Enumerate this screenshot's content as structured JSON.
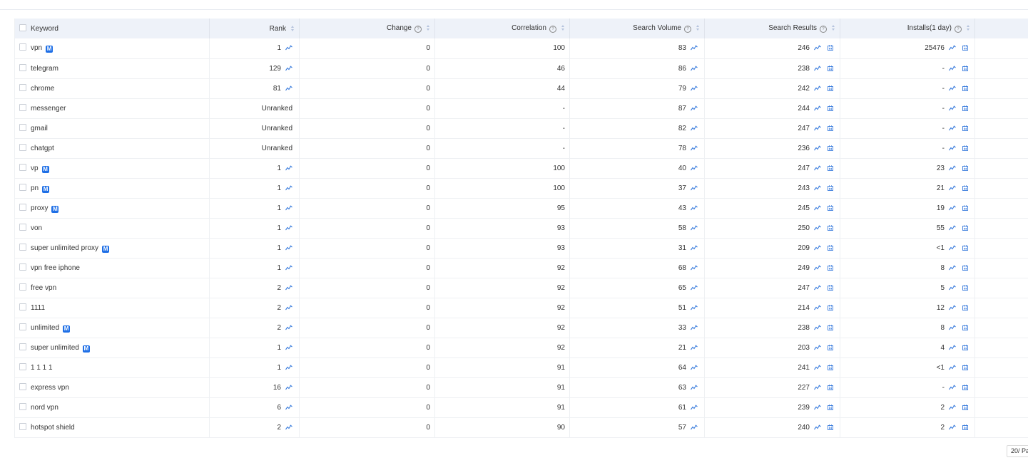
{
  "columns": {
    "keyword": "Keyword",
    "rank": "Rank",
    "change": "Change",
    "correlation": "Correlation",
    "search_volume": "Search Volume",
    "search_results": "Search Results",
    "installs": "Installs(1 day)"
  },
  "badge_label": "M",
  "pager_label": "20/ Pa",
  "rows": [
    {
      "keyword": "vpn",
      "badge": true,
      "rank": "1",
      "change": "0",
      "correlation": "100",
      "volume": "83",
      "results": "246",
      "installs": "25476"
    },
    {
      "keyword": "telegram",
      "badge": false,
      "rank": "129",
      "change": "0",
      "correlation": "46",
      "volume": "86",
      "results": "238",
      "installs": "-"
    },
    {
      "keyword": "chrome",
      "badge": false,
      "rank": "81",
      "change": "0",
      "correlation": "44",
      "volume": "79",
      "results": "242",
      "installs": "-"
    },
    {
      "keyword": "messenger",
      "badge": false,
      "rank": "Unranked",
      "change": "0",
      "correlation": "-",
      "volume": "87",
      "results": "244",
      "installs": "-"
    },
    {
      "keyword": "gmail",
      "badge": false,
      "rank": "Unranked",
      "change": "0",
      "correlation": "-",
      "volume": "82",
      "results": "247",
      "installs": "-"
    },
    {
      "keyword": "chatgpt",
      "badge": false,
      "rank": "Unranked",
      "change": "0",
      "correlation": "-",
      "volume": "78",
      "results": "236",
      "installs": "-"
    },
    {
      "keyword": "vp",
      "badge": true,
      "rank": "1",
      "change": "0",
      "correlation": "100",
      "volume": "40",
      "results": "247",
      "installs": "23"
    },
    {
      "keyword": "pn",
      "badge": true,
      "rank": "1",
      "change": "0",
      "correlation": "100",
      "volume": "37",
      "results": "243",
      "installs": "21"
    },
    {
      "keyword": "proxy",
      "badge": true,
      "rank": "1",
      "change": "0",
      "correlation": "95",
      "volume": "43",
      "results": "245",
      "installs": "19"
    },
    {
      "keyword": "von",
      "badge": false,
      "rank": "1",
      "change": "0",
      "correlation": "93",
      "volume": "58",
      "results": "250",
      "installs": "55"
    },
    {
      "keyword": "super unlimited proxy",
      "badge": true,
      "rank": "1",
      "change": "0",
      "correlation": "93",
      "volume": "31",
      "results": "209",
      "installs": "<1"
    },
    {
      "keyword": "vpn free iphone",
      "badge": false,
      "rank": "1",
      "change": "0",
      "correlation": "92",
      "volume": "68",
      "results": "249",
      "installs": "8"
    },
    {
      "keyword": "free vpn",
      "badge": false,
      "rank": "2",
      "change": "0",
      "correlation": "92",
      "volume": "65",
      "results": "247",
      "installs": "5"
    },
    {
      "keyword": "1111",
      "badge": false,
      "rank": "2",
      "change": "0",
      "correlation": "92",
      "volume": "51",
      "results": "214",
      "installs": "12"
    },
    {
      "keyword": "unlimited",
      "badge": true,
      "rank": "2",
      "change": "0",
      "correlation": "92",
      "volume": "33",
      "results": "238",
      "installs": "8"
    },
    {
      "keyword": "super unlimited",
      "badge": true,
      "rank": "1",
      "change": "0",
      "correlation": "92",
      "volume": "21",
      "results": "203",
      "installs": "4"
    },
    {
      "keyword": "1 1 1 1",
      "badge": false,
      "rank": "1",
      "change": "0",
      "correlation": "91",
      "volume": "64",
      "results": "241",
      "installs": "<1"
    },
    {
      "keyword": "express vpn",
      "badge": false,
      "rank": "16",
      "change": "0",
      "correlation": "91",
      "volume": "63",
      "results": "227",
      "installs": "-"
    },
    {
      "keyword": "nord vpn",
      "badge": false,
      "rank": "6",
      "change": "0",
      "correlation": "91",
      "volume": "61",
      "results": "239",
      "installs": "2"
    },
    {
      "keyword": "hotspot shield",
      "badge": false,
      "rank": "2",
      "change": "0",
      "correlation": "90",
      "volume": "57",
      "results": "240",
      "installs": "2"
    }
  ]
}
